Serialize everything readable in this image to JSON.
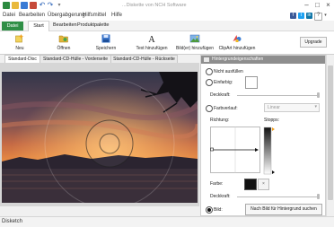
{
  "window": {
    "title": "...Diskette von NCH Software"
  },
  "menu": {
    "items": [
      "Datei",
      "Bearbeiten",
      "Übergabgerung",
      "Hilfsmittel",
      "Hilfe"
    ]
  },
  "ribbon_tabs": {
    "file": "Datei",
    "items": [
      "Start",
      "Bearbeiten",
      "Produktpalette"
    ]
  },
  "ribbon": {
    "buttons": [
      "Neu",
      "Öffnen",
      "Speichern",
      "Text hinzufügen",
      "Bild(er) hinzufügen",
      "ClipArt hinzufügen"
    ],
    "upgrade": "Upgrade"
  },
  "doc_tabs": [
    "Standard-Disc",
    "Standard-CD-Hülle - Vorderseite",
    "Standard-CD-Hülle - Rückseite"
  ],
  "panel": {
    "title": "Hintergrundeigenschaften",
    "none_label": "Nicht ausfüllen",
    "solid_label": "Einfarbig:",
    "opacity_label": "Deckkraft:",
    "gradient_label": "Farbverlauf:",
    "gradient_value": "Linear",
    "direction_label": "Richtung:",
    "stops_label": "Stopps:",
    "color_label": "Farbe:",
    "opacity2_label": "Deckkraft:",
    "image_label": "Bild:",
    "image_button": "Nach Bild für Hintergrund suchen"
  },
  "status": {
    "text": "Disketch"
  },
  "colors": {
    "brand_green": "#2f8f46",
    "panel_header": "#8e8e8e"
  }
}
